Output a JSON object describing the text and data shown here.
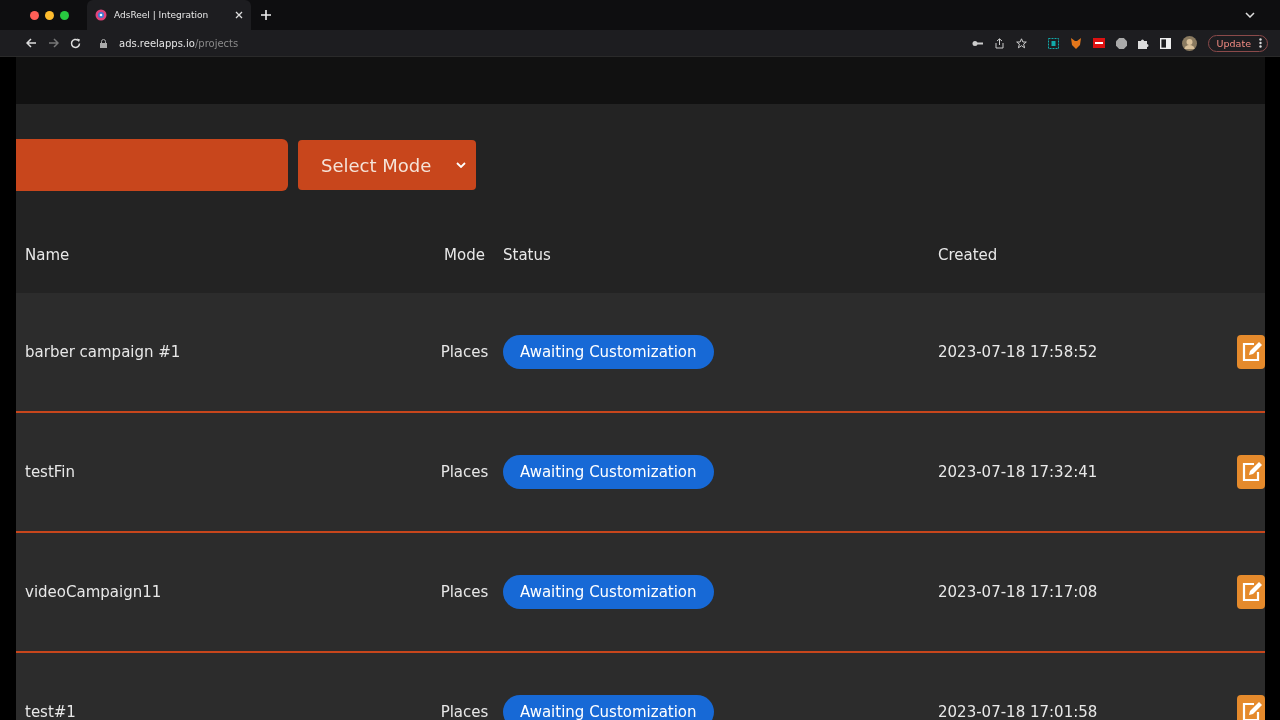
{
  "browser": {
    "tab_title": "AdsReel | Integration",
    "url_host": "ads.reelapps.io",
    "url_path": "/projects",
    "update_button": "Update"
  },
  "toolbar": {
    "mode_select": "Select Mode"
  },
  "table": {
    "columns": [
      "Name",
      "Mode",
      "Status",
      "Created"
    ],
    "rows": [
      {
        "name": "barber campaign #1",
        "mode": "Places",
        "status": "Awaiting Customization",
        "created": "2023-07-18 17:58:52"
      },
      {
        "name": "testFin",
        "mode": "Places",
        "status": "Awaiting Customization",
        "created": "2023-07-18 17:32:41"
      },
      {
        "name": "videoCampaign11",
        "mode": "Places",
        "status": "Awaiting Customization",
        "created": "2023-07-18 17:17:08"
      },
      {
        "name": "test#1",
        "mode": "Places",
        "status": "Awaiting Customization",
        "created": "2023-07-18 17:01:58"
      }
    ]
  }
}
